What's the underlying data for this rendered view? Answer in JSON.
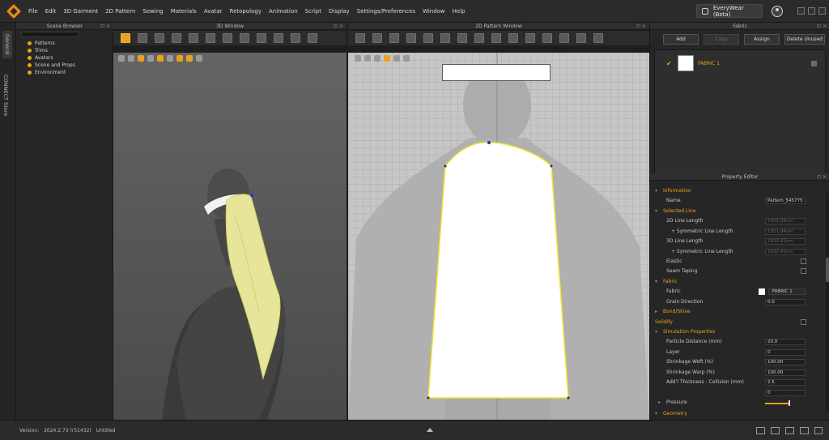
{
  "app": {
    "menu": [
      "File",
      "Edit",
      "3D Garment",
      "2D Pattern",
      "Sewing",
      "Materials",
      "Avatar",
      "Retopology",
      "Animation",
      "Script",
      "Display",
      "Settings/Preferences",
      "Window",
      "Help"
    ],
    "brand_label": "EveryWear (Beta)",
    "accent_color": "#e8a21b"
  },
  "left_strip": {
    "tabs": [
      "General",
      "CONNECT Store"
    ]
  },
  "scene_browser": {
    "title": "Scene Browser",
    "items": [
      "Patterns",
      "Trims",
      "Avatars",
      "Scene and Props",
      "Environment"
    ]
  },
  "window3d": {
    "title": "3D Window"
  },
  "window2d": {
    "title": "2D Pattern Window"
  },
  "fabric": {
    "title": "Fabric",
    "buttons": {
      "add": "Add",
      "copy": "Copy",
      "assign": "Assign",
      "delete_unused": "Delete Unused"
    },
    "items": [
      {
        "name": "FABRIC 1"
      }
    ]
  },
  "property_editor": {
    "title": "Property Editor",
    "information": "Information",
    "name_label": "Name",
    "name_value": "Pattern_545775",
    "selected_line": "Selected Line",
    "line2d_label": "2D Line Length",
    "line2d_value": "1551.04cm",
    "sym2d_label": "+ Symmetric Line Length",
    "sym2d_value": "1551.04cm",
    "line3d_label": "3D Line Length",
    "line3d_value": "1632.41cm",
    "sym3d_label": "+ Symmetric Line Length",
    "sym3d_value": "1632.41cm",
    "elastic_label": "Elastic",
    "seam_label": "Seam Taping",
    "fabric_section": "Fabric",
    "fabric_label": "Fabric",
    "fabric_value": "FABRIC 1",
    "grain_label": "Grain Direction",
    "grain_value": "0.0",
    "bond_section": "Bond/Skive",
    "solidify_label": "Solidify",
    "sim_section": "Simulation Properties",
    "particle_label": "Particle Distance (mm)",
    "particle_value": "20.0",
    "layer_label": "Layer",
    "layer_value": "0",
    "weft_label": "Shrinkage Weft (%)",
    "weft_value": "100.00",
    "warp_label": "Shrinkage Warp (%)",
    "warp_value": "100.00",
    "thickness_label": "Add'l Thickness - Collision (mm)",
    "thickness_value": "2.5",
    "pressure_label": "Pressure",
    "pressure_value": "0",
    "geometry_section": "Geometry"
  },
  "status": {
    "version_label": "Version:",
    "version_value": "2024.2.73 (r51432)",
    "file_label": "Untitled"
  }
}
